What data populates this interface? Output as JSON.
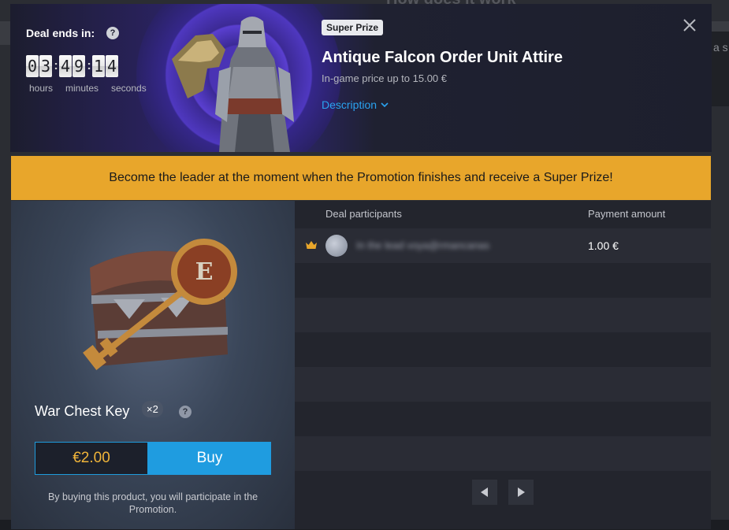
{
  "background": {
    "title": "How does it work",
    "side_text": "a s"
  },
  "timer": {
    "label": "Deal ends in:",
    "hours": [
      "0",
      "3"
    ],
    "minutes": [
      "4",
      "9"
    ],
    "seconds": [
      "1",
      "4"
    ],
    "units": {
      "hours": "hours",
      "minutes": "minutes",
      "seconds": "seconds"
    }
  },
  "prize": {
    "badge": "Super Prize",
    "title": "Antique Falcon Order Unit Attire",
    "subtitle": "In-game price up to 15.00 €",
    "description_link": "Description"
  },
  "banner": {
    "text": "Become the leader at the moment when the Promotion finishes and receive a Super Prize!"
  },
  "product": {
    "name": "War Chest Key",
    "quantity": "×2",
    "price": "€2.00",
    "buy_label": "Buy",
    "note": "By buying this product, you will participate in the Promotion."
  },
  "participants": {
    "headers": {
      "participant": "Deal participants",
      "amount": "Payment amount"
    },
    "rows": [
      {
        "name": "In the lead voya@rmancanas",
        "amount": "1.00 €"
      }
    ]
  },
  "colors": {
    "accent": "#1f9ce0",
    "banner": "#e8a62b",
    "price": "#f0b43a"
  }
}
